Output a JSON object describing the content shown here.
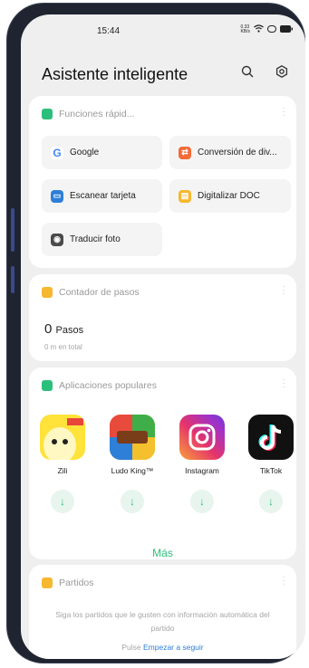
{
  "status": {
    "time": "15:44",
    "net": "0.33\nKB/s"
  },
  "header": {
    "title": "Asistente inteligente"
  },
  "quick": {
    "title": "Funciones rápid...",
    "items": [
      {
        "label": "Google",
        "icon": "google-icon"
      },
      {
        "label": "Conversión de div...",
        "icon": "currency-icon"
      },
      {
        "label": "Escanear tarjeta",
        "icon": "card-scan-icon"
      },
      {
        "label": "Digitalizar DOC",
        "icon": "doc-scan-icon"
      },
      {
        "label": "Traducir foto",
        "icon": "camera-translate-icon"
      }
    ]
  },
  "steps": {
    "title": "Contador de pasos",
    "value": "0",
    "unit": "Pasos",
    "sub": "0 m en total"
  },
  "apps": {
    "title": "Aplicaciones populares",
    "items": [
      {
        "name": "Zili"
      },
      {
        "name": "Ludo King™"
      },
      {
        "name": "Instagram"
      },
      {
        "name": "TikTok"
      }
    ],
    "more": "Más"
  },
  "matches": {
    "title": "Partidos",
    "text": "Siga los partidos que le gusten con información automática del partido",
    "pulse": "Pulse",
    "link": "Empezar a seguir"
  },
  "colors": {
    "accent_green": "#2cbf7b",
    "link_blue": "#2d7fd8",
    "background": "#efefef"
  }
}
